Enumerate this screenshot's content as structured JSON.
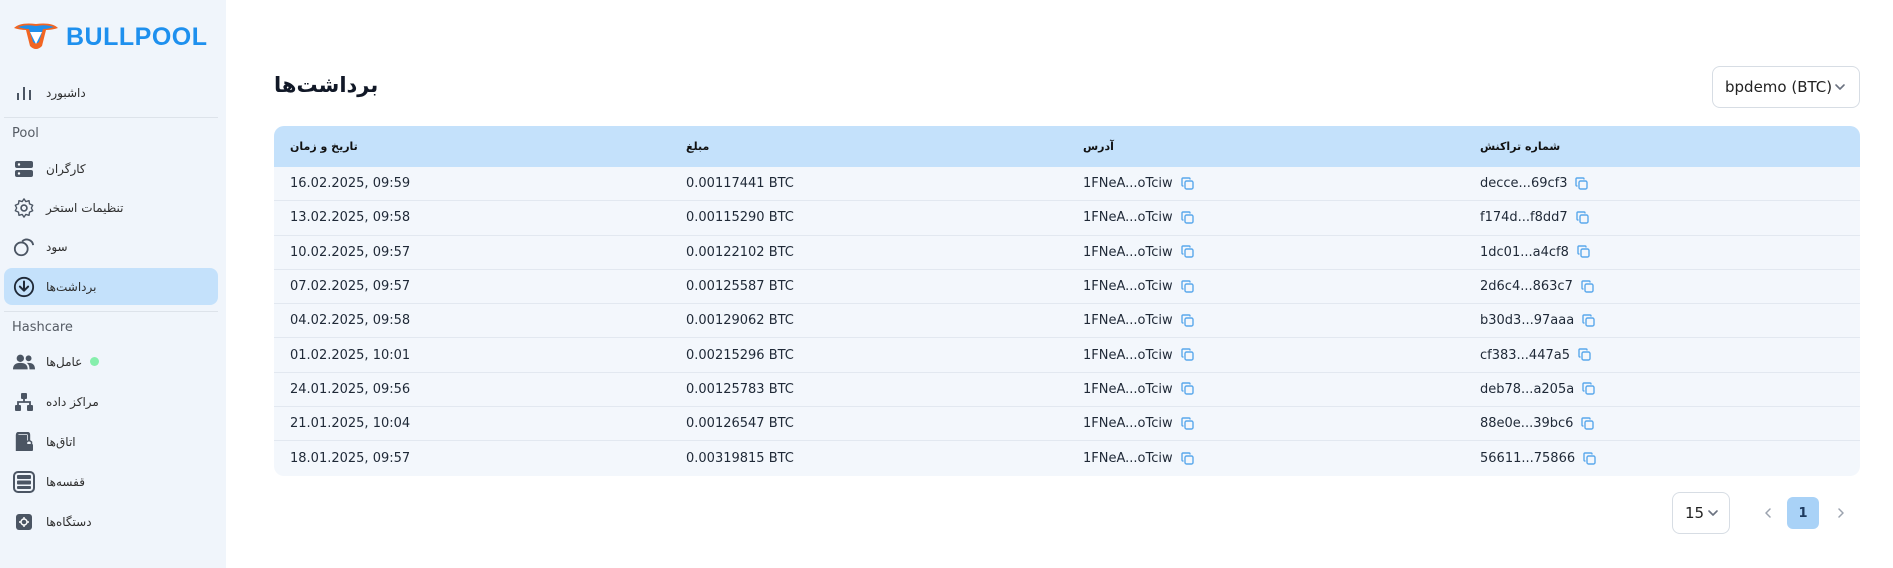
{
  "brand": {
    "name": "BULLPOOL",
    "color": "#1e90ee"
  },
  "sidebar": {
    "dashboard": {
      "label": "داشبورد",
      "icon": "bar-chart-icon"
    },
    "pool_section": "Pool",
    "pool_items": [
      {
        "label": "کارگران",
        "icon": "server-icon"
      },
      {
        "label": "تنظیمات استخر",
        "icon": "gear-icon"
      },
      {
        "label": "سود",
        "icon": "coins-icon"
      },
      {
        "label": "برداشت‌ها",
        "icon": "download-circle-icon",
        "active": true
      }
    ],
    "hashcare_section": "Hashcare",
    "hashcare_items": [
      {
        "label": "عامل‌ها",
        "icon": "users-icon",
        "status": "online"
      },
      {
        "label": "مراکز داده",
        "icon": "network-icon"
      },
      {
        "label": "اتاق‌ها",
        "icon": "door-lock-icon"
      },
      {
        "label": "قفسه‌ها",
        "icon": "rack-icon"
      },
      {
        "label": "دستگاه‌ها",
        "icon": "chip-icon"
      }
    ]
  },
  "page": {
    "title": "برداشت‌ها"
  },
  "account_select": {
    "value": "bpdemo (BTC)"
  },
  "table": {
    "headers": [
      "تاریخ و زمان",
      "مبلغ",
      "آدرس",
      "شماره تراکنش"
    ],
    "rows": [
      {
        "datetime": "16.02.2025, 09:59",
        "amount": "0.00117441 BTC",
        "address": "1FNeA...oTciw",
        "txid": "decce...69cf3"
      },
      {
        "datetime": "13.02.2025, 09:58",
        "amount": "0.00115290 BTC",
        "address": "1FNeA...oTciw",
        "txid": "f174d...f8dd7"
      },
      {
        "datetime": "10.02.2025, 09:57",
        "amount": "0.00122102 BTC",
        "address": "1FNeA...oTciw",
        "txid": "1dc01...a4cf8"
      },
      {
        "datetime": "07.02.2025, 09:57",
        "amount": "0.00125587 BTC",
        "address": "1FNeA...oTciw",
        "txid": "2d6c4...863c7"
      },
      {
        "datetime": "04.02.2025, 09:58",
        "amount": "0.00129062 BTC",
        "address": "1FNeA...oTciw",
        "txid": "b30d3...97aaa"
      },
      {
        "datetime": "01.02.2025, 10:01",
        "amount": "0.00215296 BTC",
        "address": "1FNeA...oTciw",
        "txid": "cf383...447a5"
      },
      {
        "datetime": "24.01.2025, 09:56",
        "amount": "0.00125783 BTC",
        "address": "1FNeA...oTciw",
        "txid": "deb78...a205a"
      },
      {
        "datetime": "21.01.2025, 10:04",
        "amount": "0.00126547 BTC",
        "address": "1FNeA...oTciw",
        "txid": "88e0e...39bc6"
      },
      {
        "datetime": "18.01.2025, 09:57",
        "amount": "0.00319815 BTC",
        "address": "1FNeA...oTciw",
        "txid": "56611...75866"
      }
    ]
  },
  "pagination": {
    "page_size": "15",
    "current_page": "1"
  },
  "colors": {
    "active_bg": "#c4e1fb",
    "header_bg": "#c4e1fb",
    "copy_icon": "#5aa8ec"
  }
}
